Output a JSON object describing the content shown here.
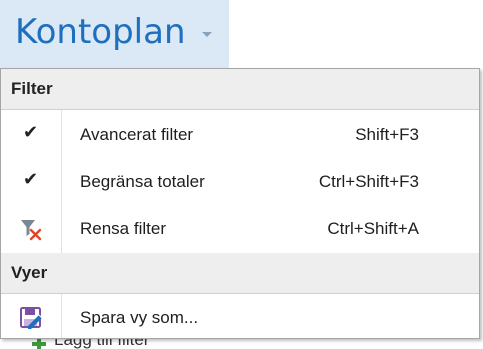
{
  "header": {
    "title": "Kontoplan",
    "dropdown_icon": "caret-down-icon"
  },
  "menu": {
    "sections": [
      {
        "label": "Filter",
        "items": [
          {
            "label": "Avancerat filter",
            "shortcut": "Shift+F3",
            "checked": true,
            "icon": "checkmark-icon"
          },
          {
            "label": "Begränsa totaler",
            "shortcut": "Ctrl+Shift+F3",
            "checked": true,
            "icon": "checkmark-icon"
          },
          {
            "label": "Rensa filter",
            "shortcut": "Ctrl+Shift+A",
            "checked": false,
            "icon": "clear-filter-icon"
          }
        ]
      },
      {
        "label": "Vyer",
        "items": [
          {
            "label": "Spara vy som...",
            "shortcut": "",
            "checked": false,
            "icon": "save-view-icon"
          }
        ]
      }
    ]
  },
  "behind": {
    "label": "Lägg till filter",
    "icon": "add-icon"
  },
  "colors": {
    "header_bg": "#dbe9f7",
    "header_text": "#1f6fbf",
    "section_bg": "#eeeeee",
    "clear_filter_x": "#e0452b",
    "save_icon_purple": "#7b4fa3",
    "add_green": "#3b9b3b"
  }
}
